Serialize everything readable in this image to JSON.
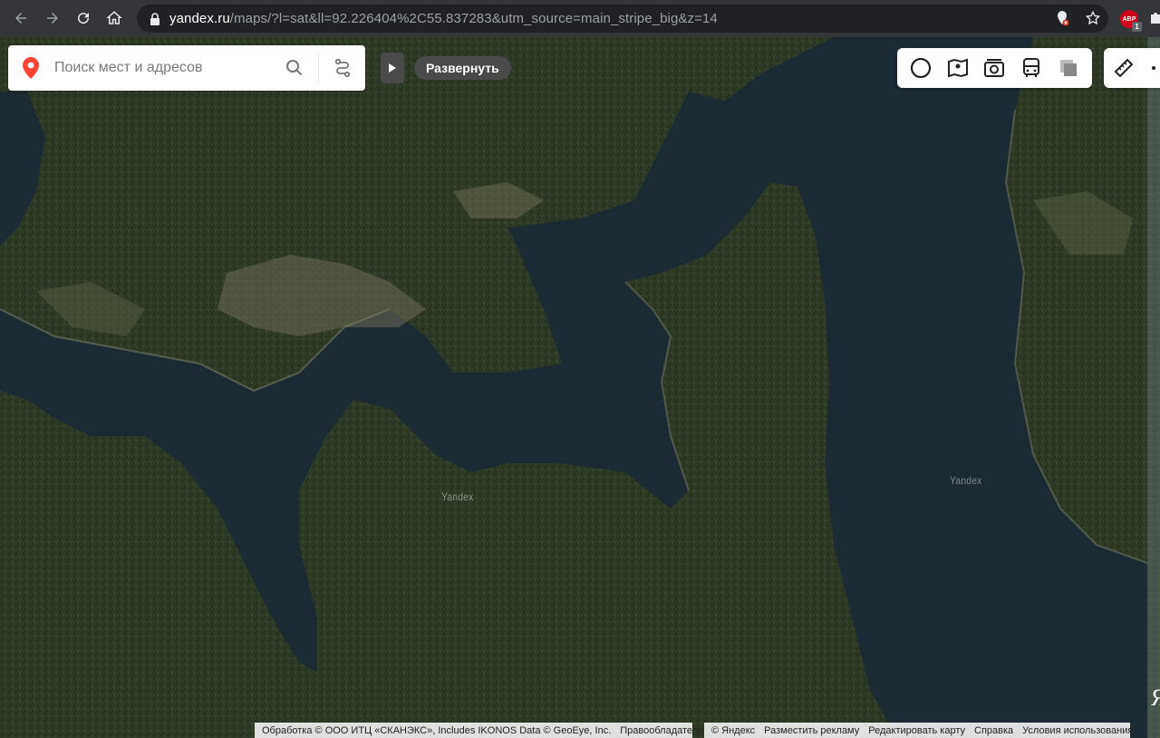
{
  "browser": {
    "url_host": "yandex.ru",
    "url_path": "/maps/?l=sat&ll=92.226404%2C55.837283&utm_source=main_stripe_big&z=14",
    "ext_abp_label": "ABP",
    "ext_abp_badge": "1"
  },
  "search": {
    "placeholder": "Поиск мест и адресов"
  },
  "panel": {
    "expand_label": "Развернуть"
  },
  "layers": {
    "icons": [
      "traffic-icon",
      "panoramas-icon",
      "photos-icon",
      "transit-icon",
      "layers-icon"
    ]
  },
  "map": {
    "watermark_1": "Yandex",
    "watermark_2": "Yandex",
    "logo": "Я"
  },
  "copyright": {
    "left_text": "Обработка © ООО ИТЦ «СКАНЭКС», Includes IKONOS Data © GeoEye, Inc.",
    "left_link": "Правообладатели",
    "right_items": [
      "© Яндекс",
      "Разместить рекламу",
      "Редактировать карту",
      "Справка",
      "Условия использования"
    ]
  },
  "colors": {
    "forest": "#2e3a26",
    "water": "#1c2a33",
    "map_pin": "#f43",
    "button_dark": "#4a4a4a"
  }
}
